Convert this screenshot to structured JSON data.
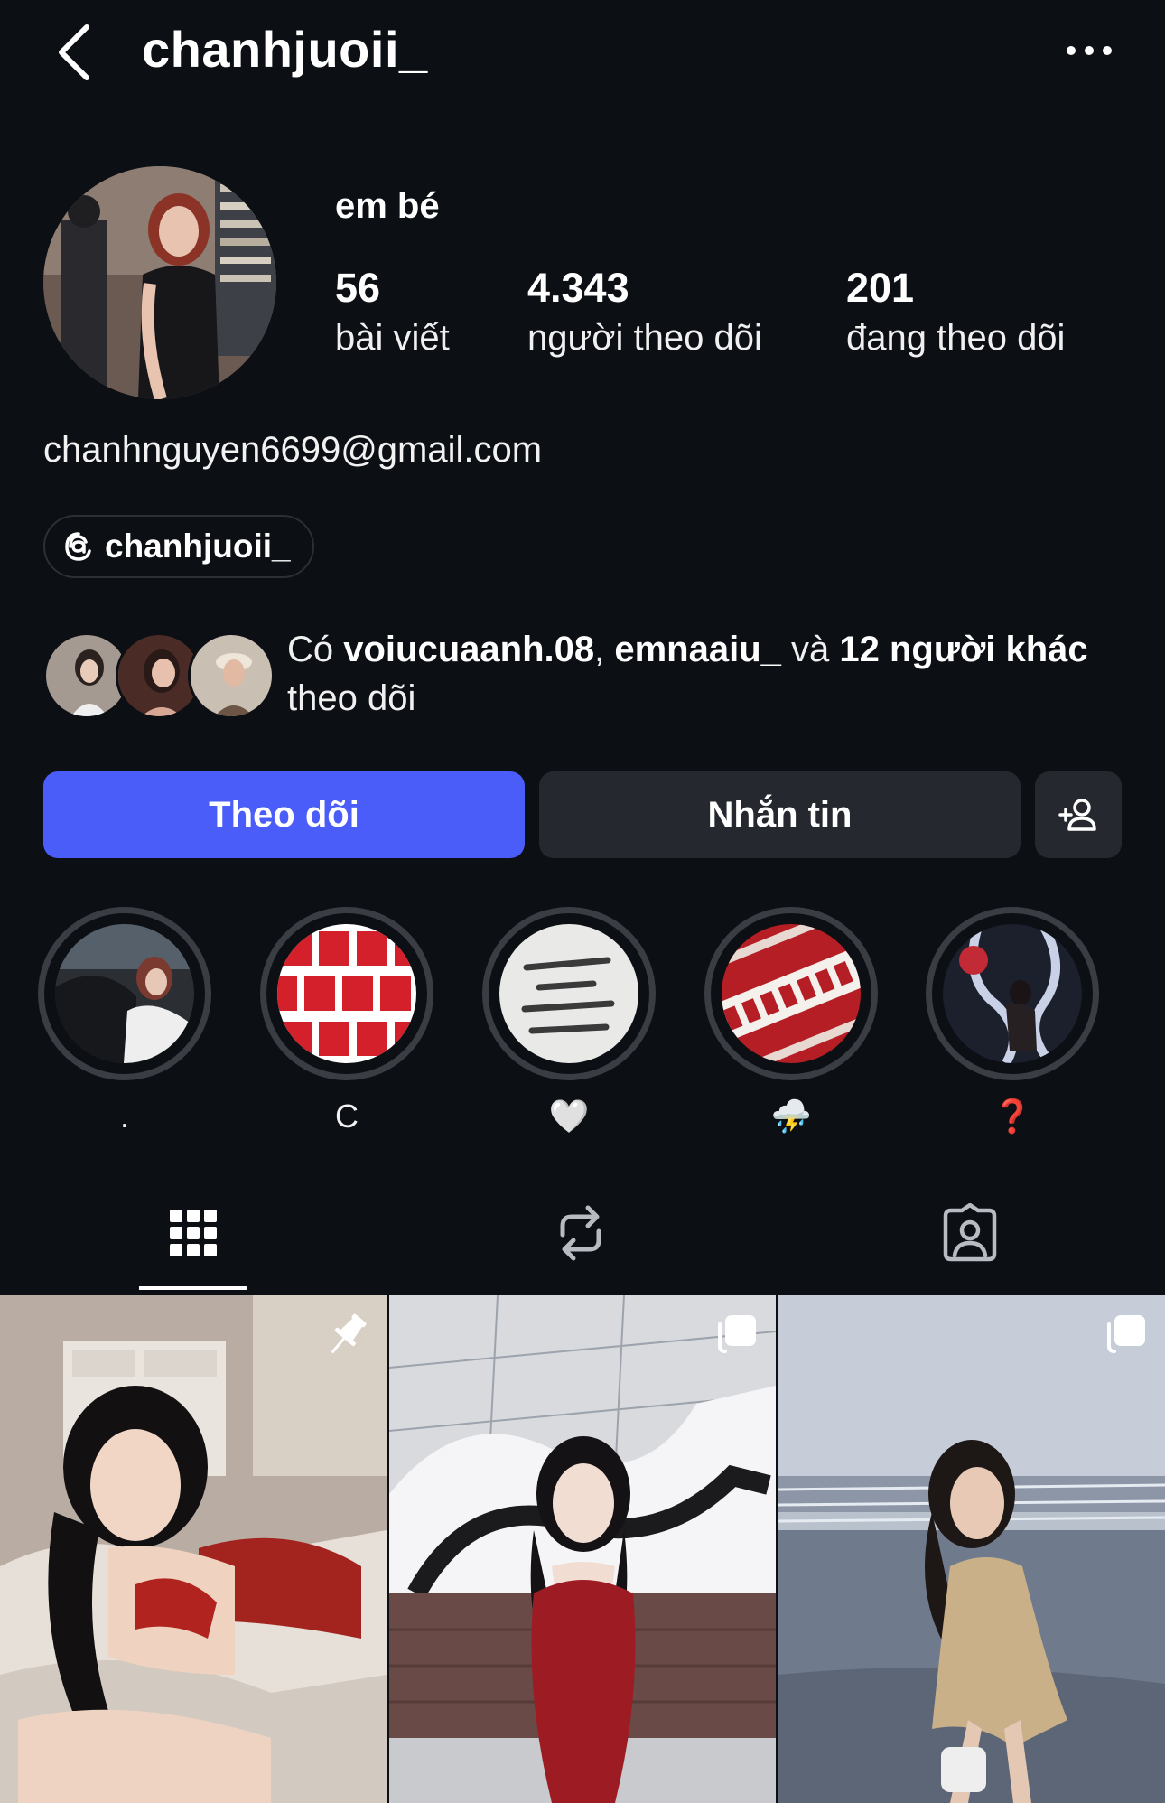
{
  "header": {
    "username": "chanhjuoii_",
    "back_icon": "chevron-left-icon",
    "more_icon": "more-horizontal-icon"
  },
  "profile": {
    "display_name": "em bé",
    "email": "chanhnguyen6699@gmail.com",
    "threads_handle": "chanhjuoii_",
    "stats": {
      "posts": {
        "value": "56",
        "label": "bài viết"
      },
      "followers": {
        "value": "4.343",
        "label": "người theo dõi"
      },
      "following": {
        "value": "201",
        "label": "đang theo dõi"
      }
    }
  },
  "mutual": {
    "prefix": "Có ",
    "user1": "voiucuaanh.08",
    "sep": ", ",
    "user2": "emnaaiu_",
    "and": " và ",
    "others": "12 người khác",
    "suffix": " theo dõi"
  },
  "actions": {
    "follow_label": "Theo dõi",
    "message_label": "Nhắn tin",
    "add_icon": "add-person-icon"
  },
  "highlights": [
    {
      "label": "."
    },
    {
      "label": "C"
    },
    {
      "label": "🤍"
    },
    {
      "label": "⛈️"
    },
    {
      "label": "❓"
    }
  ],
  "tabs": [
    {
      "icon": "grid-icon",
      "active": true
    },
    {
      "icon": "reposts-icon",
      "active": false
    },
    {
      "icon": "tagged-icon",
      "active": false
    }
  ],
  "posts": [
    {
      "badge": "pin-icon"
    },
    {
      "badge": "carousel-icon"
    },
    {
      "badge": "carousel-icon"
    }
  ],
  "colors": {
    "background": "#0c0f14",
    "follow_button": "#4a5df9",
    "secondary_button": "#25282e",
    "highlight_ring": "#3a3d44"
  }
}
